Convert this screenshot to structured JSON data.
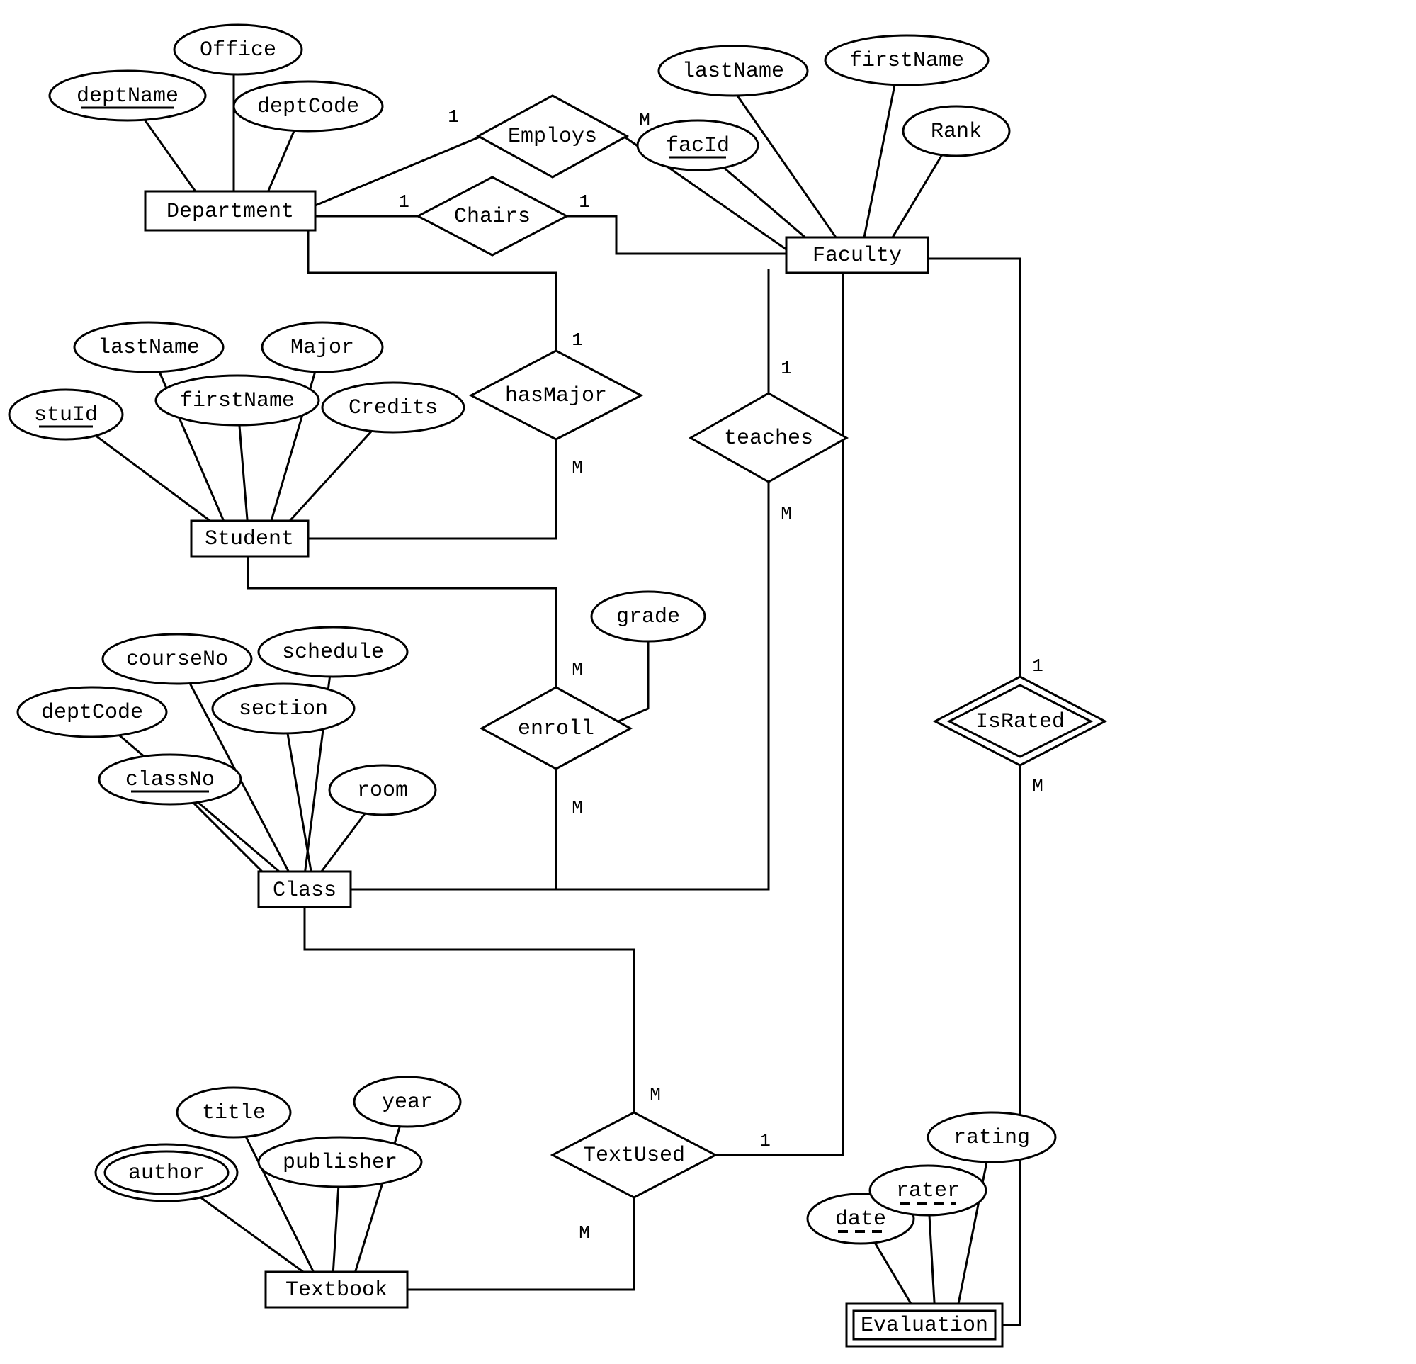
{
  "entities": {
    "department": "Department",
    "faculty": "Faculty",
    "student": "Student",
    "class": "Class",
    "textbook": "Textbook",
    "evaluation": "Evaluation"
  },
  "relationships": {
    "employs": "Employs",
    "chairs": "Chairs",
    "hasMajor": "hasMajor",
    "teaches": "teaches",
    "enroll": "enroll",
    "textUsed": "TextUsed",
    "isRated": "IsRated"
  },
  "attributes": {
    "department": {
      "deptName": "deptName",
      "office": "Office",
      "deptCode": "deptCode"
    },
    "faculty": {
      "lastName": "lastName",
      "firstName": "firstName",
      "facId": "facId",
      "rank": "Rank"
    },
    "student": {
      "stuId": "stuId",
      "lastName": "lastName",
      "firstName": "firstName",
      "major": "Major",
      "credits": "Credits"
    },
    "class": {
      "deptCode": "deptCode",
      "courseNo": "courseNo",
      "schedule": "schedule",
      "section": "section",
      "classNo": "classNo",
      "room": "room"
    },
    "enroll": {
      "grade": "grade"
    },
    "textbook": {
      "author": "author",
      "title": "title",
      "publisher": "publisher",
      "year": "year"
    },
    "evaluation": {
      "date": "date",
      "rater": "rater",
      "rating": "rating"
    }
  },
  "cardinalities": {
    "employs_dept": "1",
    "employs_fac": "M",
    "chairs_dept": "1",
    "chairs_fac": "1",
    "hasMajor_dept": "1",
    "hasMajor_stu": "M",
    "teaches_fac": "1",
    "teaches_class": "M",
    "enroll_stu": "M",
    "enroll_class": "M",
    "textUsed_class": "M",
    "textUsed_textbook": "M",
    "textUsed_fac": "1",
    "isRated_fac": "1",
    "isRated_eval": "M"
  }
}
